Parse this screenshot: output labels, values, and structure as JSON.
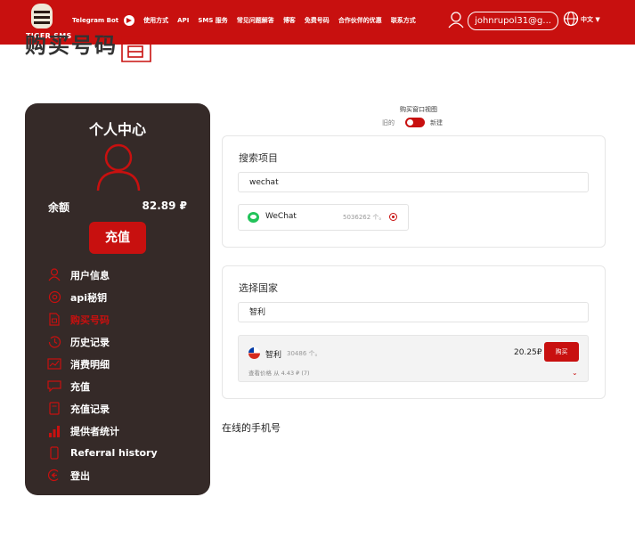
{
  "header": {
    "logo_text": "TIGER SMS",
    "nav": [
      "Telegram Bot",
      "使用方式",
      "API",
      "SMS 服务",
      "常见问题解答",
      "博客",
      "免费号码",
      "合作伙伴的优惠",
      "联系方式"
    ],
    "email": "johnrupol31@g...",
    "language": "中文 ▼"
  },
  "page": {
    "title": "购买号码"
  },
  "sidebar": {
    "title": "个人中心",
    "balance_label": "余额",
    "balance_value": "82.89 ₽",
    "topup_button": "充值",
    "menu": [
      {
        "label": "用户信息",
        "icon": "user-icon"
      },
      {
        "label": "api秘钥",
        "icon": "api-key-icon"
      },
      {
        "label": "购买号码",
        "icon": "sim-card-icon",
        "active": true
      },
      {
        "label": "历史记录",
        "icon": "history-icon"
      },
      {
        "label": "消费明细",
        "icon": "chart-icon"
      },
      {
        "label": "充值",
        "icon": "wallet-icon"
      },
      {
        "label": "充值记录",
        "icon": "receipt-icon"
      },
      {
        "label": "提供者统计",
        "icon": "bar-stats-icon"
      },
      {
        "label": "Referral history",
        "icon": "phone-icon"
      },
      {
        "label": "登出",
        "icon": "logout-icon"
      }
    ]
  },
  "view_switch": {
    "label": "购买窗口视图",
    "old": "旧的",
    "new": "新建",
    "state": "new"
  },
  "service_search": {
    "title": "搜索项目",
    "value": "wechat",
    "result": {
      "name": "WeChat",
      "count": "5036262 个。",
      "selected": true
    }
  },
  "country_select": {
    "title": "选择国家",
    "value": "智利",
    "result": {
      "name": "智利",
      "count": "30486 个。",
      "price": "20.25₽",
      "buy_button": "购买",
      "price_hint": "查看价格 从 4.43 ₽ (7)"
    }
  },
  "online_numbers": {
    "title": "在线的手机号"
  },
  "colors": {
    "brand_red": "#c8100f",
    "sidebar_bg": "#352a28"
  }
}
